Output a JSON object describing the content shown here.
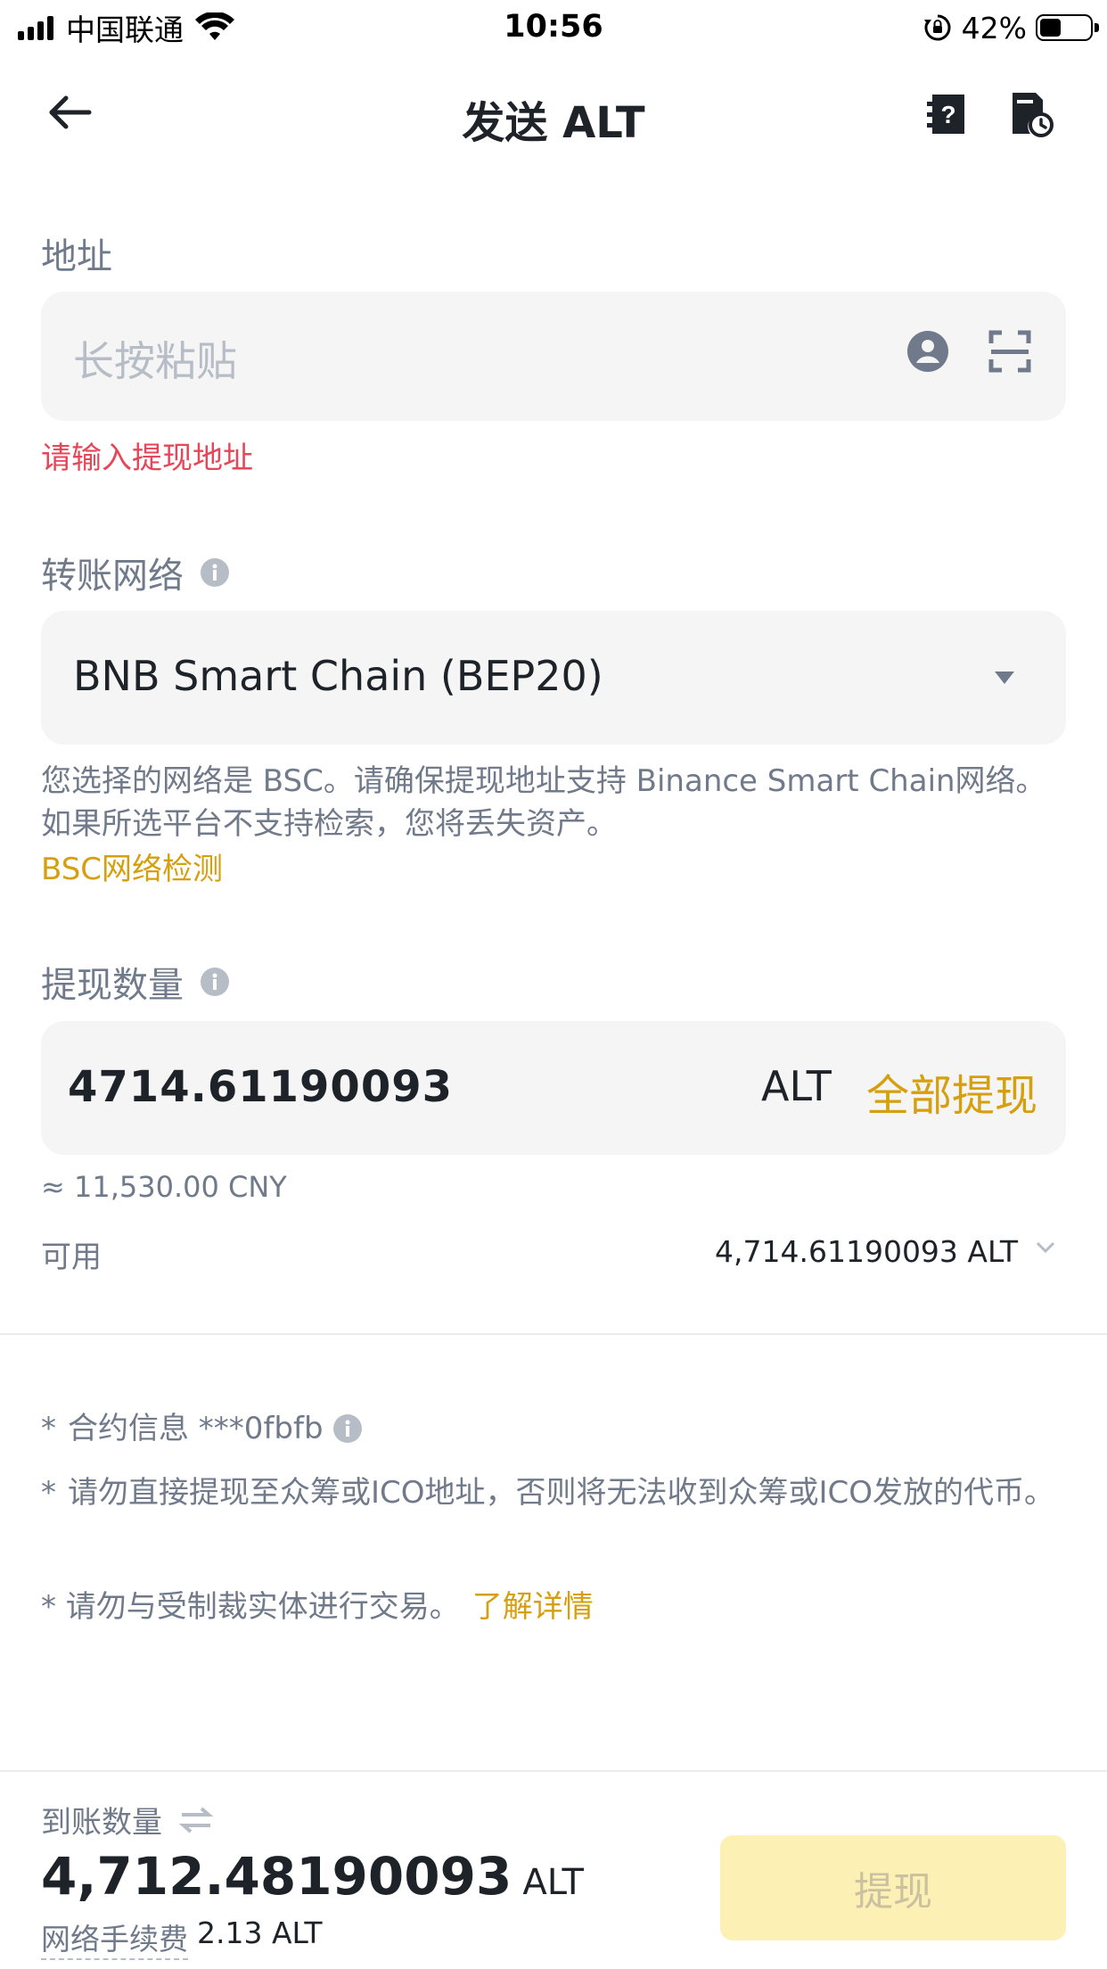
{
  "status_bar": {
    "carrier": "中国联通",
    "time": "10:56",
    "battery_percent": "42%",
    "battery_level": 0.42
  },
  "header": {
    "title": "发送 ALT",
    "back_icon": "arrow-left-icon",
    "help_icon": "help-document-icon",
    "history_icon": "document-clock-icon"
  },
  "address": {
    "label": "地址",
    "placeholder": "长按粘贴",
    "error": "请输入提现地址"
  },
  "network": {
    "label": "转账网络",
    "selected": "BNB Smart Chain (BEP20)",
    "note": "您选择的网络是 BSC。请确保提现地址支持 Binance Smart Chain网络。如果所选平台不支持检索，您将丢失资产。",
    "check_link": "BSC网络检测"
  },
  "amount": {
    "label": "提现数量",
    "value": "4714.61190093",
    "unit": "ALT",
    "withdraw_all": "全部提现",
    "approx": "≈ 11,530.00 CNY",
    "available_label": "可用",
    "available_value": "4,714.61190093 ALT"
  },
  "notes": {
    "contract_info": "合约信息 ***0fbfb",
    "ico_warning": "请勿直接提现至众筹或ICO地址，否则将无法收到众筹或ICO发放的代币。",
    "sanction_warning": "* 请勿与受制裁实体进行交易。",
    "learn_more": "了解详情",
    "star": "*"
  },
  "footer": {
    "receive_label": "到账数量",
    "receive_value": "4,712.48190093",
    "receive_unit": "ALT",
    "fee_label": "网络手续费",
    "fee_value": "2.13 ALT",
    "withdraw_button": "提现"
  },
  "colors": {
    "accent": "#d69f0e",
    "error": "#e74558",
    "field_bg": "#f5f5f5",
    "button_disabled_bg": "#fcf0b4"
  }
}
